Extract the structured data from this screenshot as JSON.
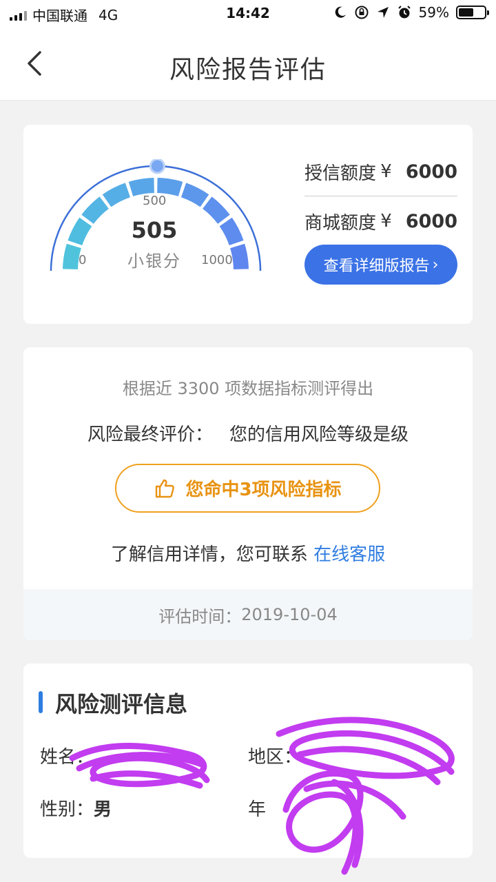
{
  "status_bar": {
    "carrier": "中国联通",
    "network": "4G",
    "time": "14:42",
    "battery": "59%",
    "battery_level": 0.59
  },
  "nav": {
    "title": "风险报告评估"
  },
  "score_card": {
    "gauge": {
      "min_label": "0",
      "mid_label": "500",
      "max_label": "1000",
      "min": 0,
      "max": 1000,
      "score": 505
    },
    "score_text": "505",
    "score_unit": "小银分",
    "quotas": [
      {
        "label": "授信额度",
        "currency": "¥",
        "value": "6000"
      },
      {
        "label": "商城额度",
        "currency": "¥",
        "value": "6000"
      }
    ],
    "detail_button": "查看详细版报告",
    "detail_button_arrow": "›"
  },
  "evaluation_card": {
    "basis_text": "根据近 3300 项数据指标测评得出",
    "final_label": "风险最终评价：",
    "final_value": "您的信用风险等级是级",
    "risk_button": "您命中3项风险指标",
    "contact_text": "了解信用详情，您可联系",
    "contact_link": "在线客服",
    "eval_time_label": "评估时间：",
    "eval_time_value": "2019-10-04"
  },
  "info_card": {
    "title": "风险测评信息",
    "fields": [
      {
        "label": "姓名：",
        "value": ""
      },
      {
        "label": "地区：",
        "value": ""
      },
      {
        "label": "性别：",
        "value": "男"
      },
      {
        "label": "年",
        "value": ""
      }
    ]
  },
  "colors": {
    "primary_blue": "#3b72e6",
    "link_blue": "#2f7de0",
    "warning_orange": "#e89312",
    "redaction_purple": "#c23cf0"
  }
}
